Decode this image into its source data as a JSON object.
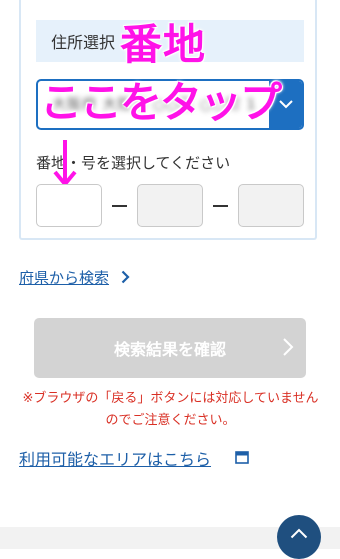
{
  "address_select": {
    "heading": "住所選択",
    "selected_value": "大阪府 大阪市 ○○区 ○○町 1",
    "dropdown_icon": "chevron-down-icon"
  },
  "annotations": {
    "line1": "番地",
    "line2": "ここをタップ",
    "color": "#ff12e8",
    "arrow_icon": "down-arrow-icon"
  },
  "number_select": {
    "label": "番地・号を選択してください",
    "fields": [
      "",
      "",
      ""
    ]
  },
  "links": {
    "prefecture_search": "府県から検索",
    "available_area": "利用可能なエリアはこちら"
  },
  "confirm_button": {
    "label": "検索結果を確認",
    "state": "disabled"
  },
  "notice": "※ブラウザの「戻る」ボタンには対応していませんのでご注意ください。",
  "colors": {
    "accent_blue": "#1d6fc1",
    "link_blue": "#1d5fa8",
    "notice_red": "#d93025",
    "page_top_button": "#1f4f7f"
  },
  "page_top_icon": "chevron-up-icon"
}
